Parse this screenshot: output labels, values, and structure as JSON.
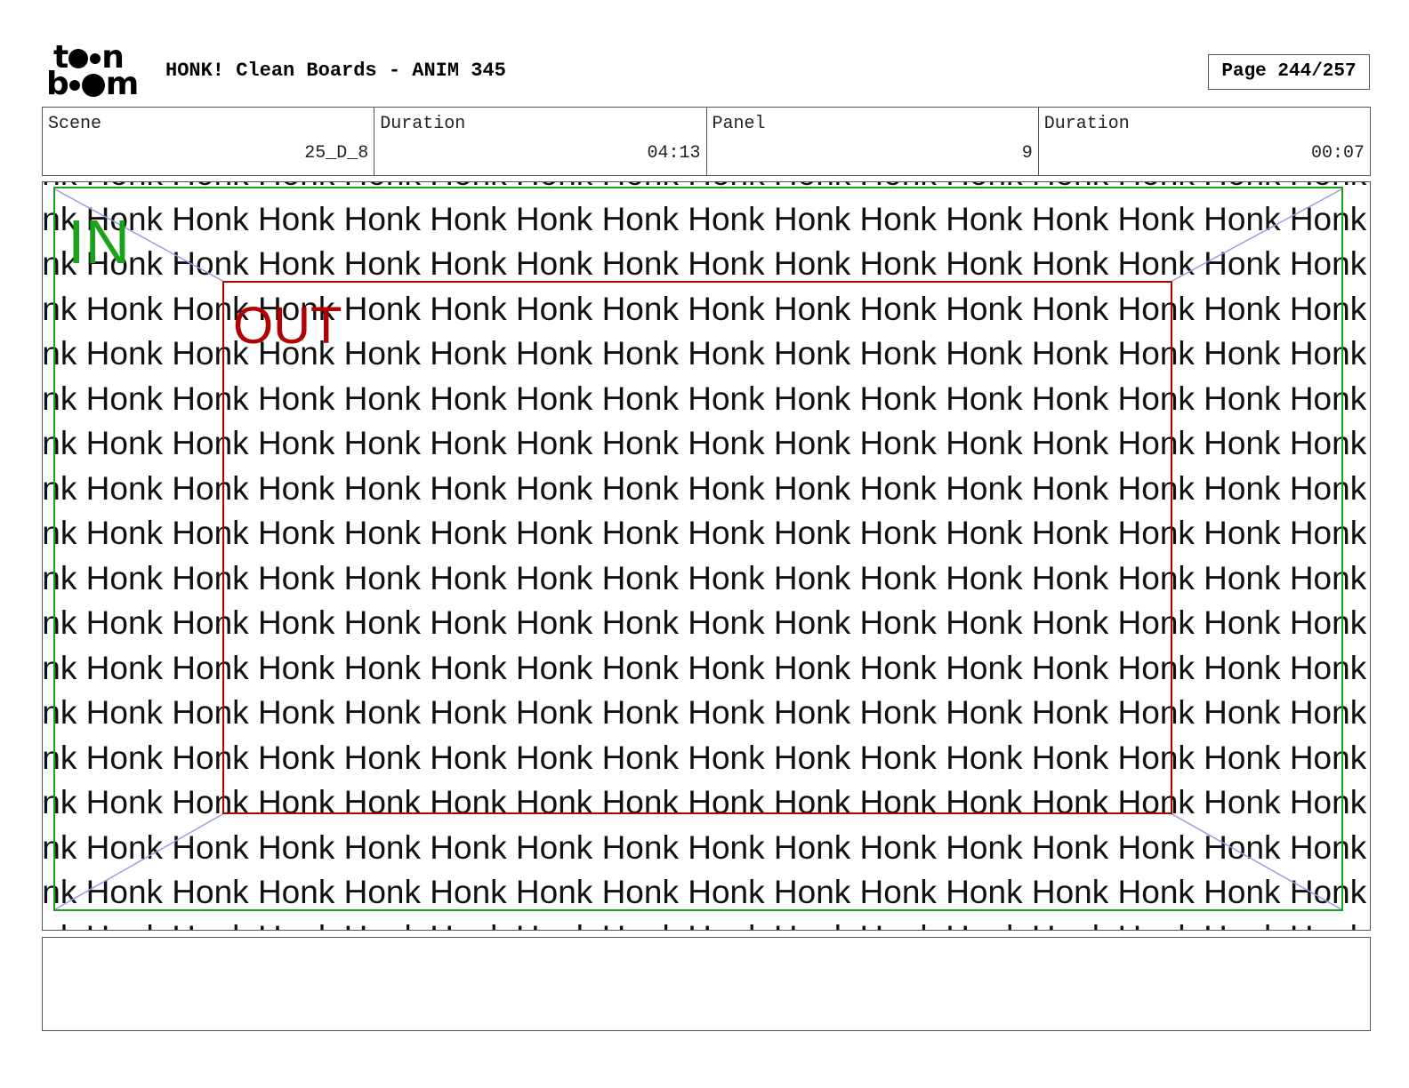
{
  "logo": {
    "line1": "t",
    "line1_end": "n",
    "line2": "b",
    "line2_end": "m",
    "brand_alt": "toon boom"
  },
  "header": {
    "title": "HONK! Clean Boards - ANIM 345",
    "page": "Page 244/257"
  },
  "info": {
    "scene_label": "Scene",
    "scene_value": "25_D_8",
    "scene_duration_label": "Duration",
    "scene_duration_value": "04:13",
    "panel_label": "Panel",
    "panel_value": "9",
    "panel_duration_label": "Duration",
    "panel_duration_value": "00:07"
  },
  "panel": {
    "repeated_word": "Honk",
    "in_label": "IN",
    "out_label": "OUT",
    "colors": {
      "in_frame": "#1aa31a",
      "out_frame": "#b30000",
      "camera_path": "#9a9ae8"
    }
  },
  "notes": {
    "text": ""
  }
}
